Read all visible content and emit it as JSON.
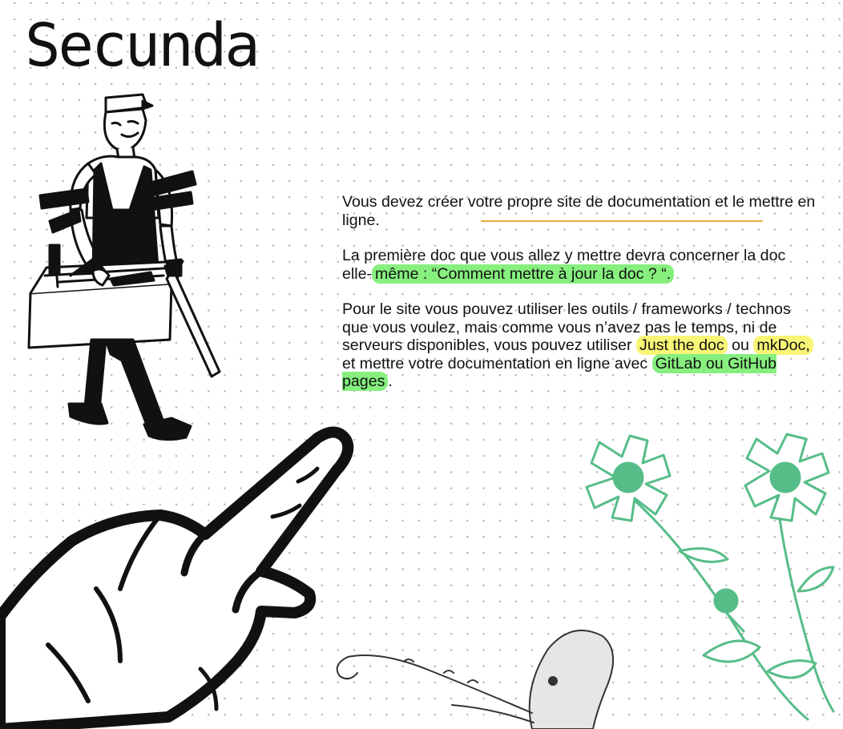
{
  "page": {
    "title": "Secunda"
  },
  "content": {
    "paragraphs": [
      {
        "segments": [
          {
            "text": "Vous devez créer votre propre site de documentation et le mettre en ligne.",
            "highlight": null
          }
        ]
      },
      {
        "segments": [
          {
            "text": "La première doc que vous allez y mettre devra concerner la doc elle-",
            "highlight": null
          },
          {
            "text": "même : “Comment mettre à jour la doc ? “.",
            "highlight": "green"
          }
        ]
      },
      {
        "segments": [
          {
            "text": "Pour le site vous pouvez utiliser les outils / frameworks / technos que vous voulez, mais comme vous n’avez pas le temps, ni de serveurs disponibles, vous pouvez utiliser ",
            "highlight": null
          },
          {
            "text": "Just the doc",
            "highlight": "yellow"
          },
          {
            "text": " ou ",
            "highlight": null
          },
          {
            "text": "mkDoc,",
            "highlight": "yellow"
          },
          {
            "text": " et mettre votre documentation en ligne avec ",
            "highlight": null
          },
          {
            "text": "GitLab ou GitHub pages",
            "highlight": "green"
          },
          {
            "text": ".",
            "highlight": null
          }
        ]
      }
    ]
  },
  "illustrations": [
    {
      "name": "worker-with-toolbox-illustration"
    },
    {
      "name": "pointing-hand-illustration"
    },
    {
      "name": "chamomile-flowers-illustration"
    },
    {
      "name": "octopus-illustration"
    }
  ],
  "colors": {
    "text": "#111111",
    "background": "#ffffff",
    "grid_dots": "#b9b9b9",
    "highlight_green": "#86ef7e",
    "highlight_yellow": "#f9f576",
    "accent_underline": "#eaa83a",
    "flower_green": "#57bd88"
  }
}
